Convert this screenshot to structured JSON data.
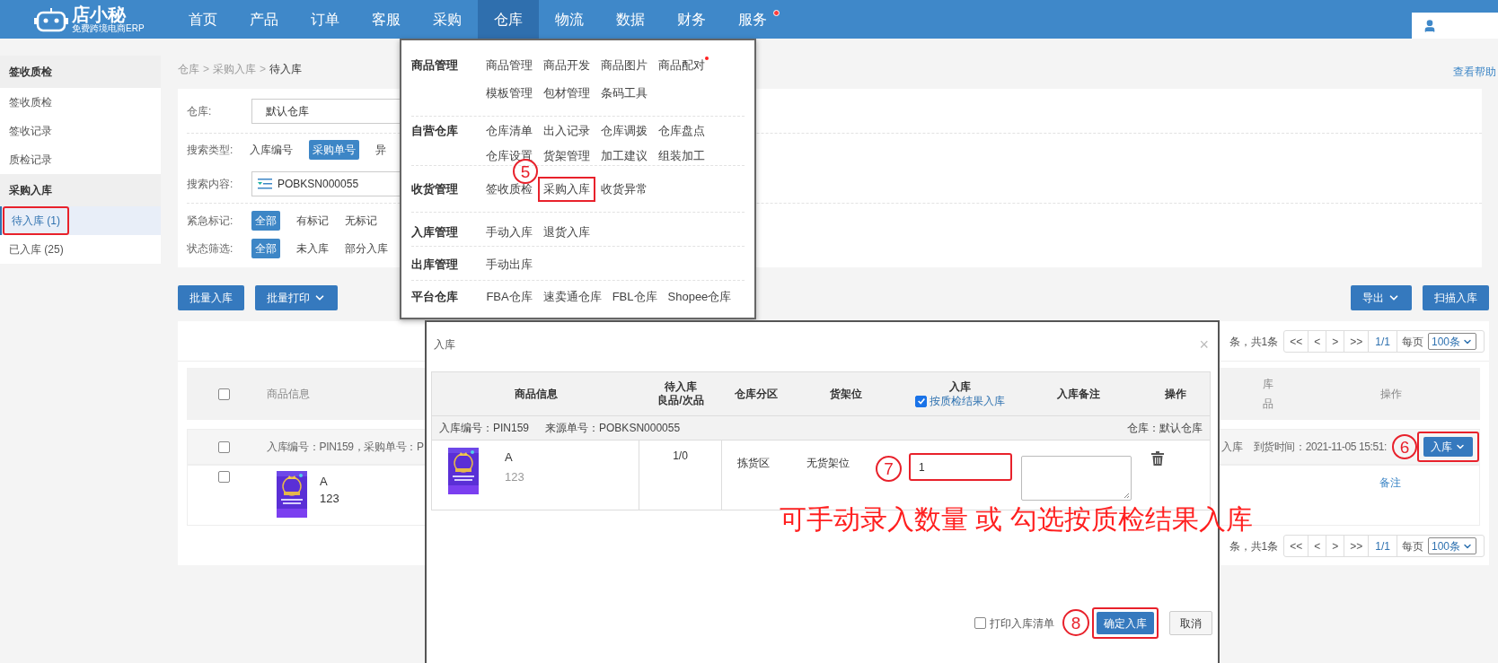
{
  "top_nav": {
    "logo": {
      "name": "店小秘",
      "tagline": "免费跨境电商ERP"
    },
    "items": [
      {
        "label": "首页",
        "selected": false,
        "dot": false
      },
      {
        "label": "产品",
        "selected": false,
        "dot": false
      },
      {
        "label": "订单",
        "selected": false,
        "dot": false
      },
      {
        "label": "客服",
        "selected": false,
        "dot": false
      },
      {
        "label": "采购",
        "selected": false,
        "dot": false
      },
      {
        "label": "仓库",
        "selected": true,
        "dot": false
      },
      {
        "label": "物流",
        "selected": false,
        "dot": false
      },
      {
        "label": "数据",
        "selected": false,
        "dot": false
      },
      {
        "label": "财务",
        "selected": false,
        "dot": false
      },
      {
        "label": "服务",
        "selected": false,
        "dot": true
      }
    ]
  },
  "sidebar": {
    "sections": [
      {
        "title": "签收质检",
        "items": [
          {
            "label": "签收质检",
            "selected": false,
            "highlighted": false
          },
          {
            "label": "签收记录",
            "selected": false,
            "highlighted": false
          },
          {
            "label": "质检记录",
            "selected": false,
            "highlighted": false
          }
        ]
      },
      {
        "title": "采购入库",
        "items": [
          {
            "label": "待入库 (1)",
            "selected": true,
            "highlighted": true
          },
          {
            "label": "已入库 (25)",
            "selected": false,
            "highlighted": false
          }
        ]
      }
    ]
  },
  "breadcrumb": [
    {
      "kind": "link",
      "label": "仓库"
    },
    {
      "kind": "separator",
      "label": ">"
    },
    {
      "kind": "link",
      "label": "采购入库"
    },
    {
      "kind": "separator",
      "label": ">"
    },
    {
      "kind": "current",
      "label": "待入库"
    }
  ],
  "help_link": "查看帮助",
  "filters": {
    "warehouse": {
      "label": "仓库:",
      "value": "默认仓库"
    },
    "search_type": {
      "label": "搜索类型:",
      "options": [
        {
          "label": "入库编号",
          "selected": false
        },
        {
          "label": "采购单号",
          "selected": true
        },
        {
          "label": "异",
          "selected": false
        }
      ]
    },
    "search_content": {
      "label": "搜索内容:",
      "value": "POBKSN000055"
    },
    "urgent_mark": {
      "label": "紧急标记:",
      "options": [
        {
          "label": "全部",
          "selected": true
        },
        {
          "label": "有标记",
          "selected": false
        },
        {
          "label": "无标记",
          "selected": false
        }
      ]
    },
    "status": {
      "label": "状态筛选:",
      "options": [
        {
          "label": "全部",
          "selected": true
        },
        {
          "label": "未入库",
          "selected": false
        },
        {
          "label": "部分入库",
          "selected": false
        }
      ]
    }
  },
  "actions_left": [
    {
      "label": "批量入库",
      "dropdown": false
    },
    {
      "label": "批量打印",
      "dropdown": true
    }
  ],
  "actions_right": [
    {
      "label": "导出",
      "dropdown": true
    },
    {
      "label": "扫描入库",
      "dropdown": false
    }
  ],
  "table": {
    "pagination_top": {
      "summary": "条，共1条",
      "buttons": [
        "<<",
        "<",
        ">",
        ">>"
      ],
      "page": "1/1",
      "per_page_label": "每页",
      "per_page": "100条"
    },
    "header": {
      "checked": false,
      "product": "商品信息",
      "cut_column": [
        "库",
        "品"
      ],
      "actions": "操作"
    },
    "group": {
      "checked": false,
      "info": "入库编号：PIN159，采购单号：P",
      "cut_text": "入库",
      "arrival": "到货时间：2021-11-05 15:51:",
      "action": {
        "label": "入库",
        "highlighted": true
      }
    },
    "product": {
      "checked": false,
      "name": "A",
      "code": "123",
      "note_link": "备注"
    },
    "pagination_bottom": {
      "summary": "条，共1条",
      "buttons": [
        "<<",
        "<",
        ">",
        ">>"
      ],
      "page": "1/1",
      "per_page_label": "每页",
      "per_page": "100条"
    }
  },
  "warehouse_menu": {
    "groups": [
      {
        "title": "商品管理",
        "links": [
          {
            "label": "商品管理",
            "highlighted": false,
            "dot": false
          },
          {
            "label": "商品开发",
            "highlighted": false,
            "dot": false
          },
          {
            "label": "商品图片",
            "highlighted": false,
            "dot": false
          },
          {
            "label": "商品配对",
            "highlighted": false,
            "dot": true
          },
          {
            "label": "模板管理",
            "highlighted": false,
            "dot": false
          },
          {
            "label": "包材管理",
            "highlighted": false,
            "dot": false
          },
          {
            "label": "条码工具",
            "highlighted": false,
            "dot": false
          }
        ]
      },
      {
        "title": "自营仓库",
        "links": [
          {
            "label": "仓库清单",
            "highlighted": false,
            "dot": false
          },
          {
            "label": "出入记录",
            "highlighted": false,
            "dot": false
          },
          {
            "label": "仓库调拨",
            "highlighted": false,
            "dot": false
          },
          {
            "label": "仓库盘点",
            "highlighted": false,
            "dot": false
          },
          {
            "label": "仓库设置",
            "highlighted": false,
            "dot": false
          },
          {
            "label": "货架管理",
            "highlighted": false,
            "dot": false
          },
          {
            "label": "加工建议",
            "highlighted": false,
            "dot": false
          },
          {
            "label": "组装加工",
            "highlighted": false,
            "dot": false
          }
        ]
      },
      {
        "title": "收货管理",
        "links": [
          {
            "label": "签收质检",
            "highlighted": false,
            "dot": false
          },
          {
            "label": "采购入库",
            "highlighted": true,
            "dot": false
          },
          {
            "label": "收货异常",
            "highlighted": false,
            "dot": false
          }
        ]
      },
      {
        "title": "入库管理",
        "links": [
          {
            "label": "手动入库",
            "highlighted": false,
            "dot": false
          },
          {
            "label": "退货入库",
            "highlighted": false,
            "dot": false
          }
        ]
      },
      {
        "title": "出库管理",
        "links": [
          {
            "label": "手动出库",
            "highlighted": false,
            "dot": false
          }
        ]
      },
      {
        "title": "平台仓库",
        "links": [
          {
            "label": "FBA仓库",
            "highlighted": false,
            "dot": false
          },
          {
            "label": "速卖通仓库",
            "highlighted": false,
            "dot": false
          },
          {
            "label": "FBL仓库",
            "highlighted": false,
            "dot": false
          },
          {
            "label": "Shopee仓库",
            "highlighted": false,
            "dot": false
          }
        ]
      }
    ]
  },
  "modal": {
    "title": "入库",
    "close": "×",
    "columns": [
      {
        "kind": "text",
        "label": "商品信息"
      },
      {
        "kind": "stacked",
        "lines": [
          "待入库",
          "良品/次品"
        ]
      },
      {
        "kind": "text",
        "label": "仓库分区"
      },
      {
        "kind": "text",
        "label": "货架位"
      },
      {
        "kind": "check",
        "label": "入库",
        "check_label": "按质检结果入库",
        "checked": true
      },
      {
        "kind": "text",
        "label": "入库备注"
      },
      {
        "kind": "text",
        "label": "操作"
      }
    ],
    "info": {
      "inbound_no": "入库编号：PIN159",
      "source_no": "来源单号：POBKSN000055",
      "warehouse": "仓库：默认仓库"
    },
    "row": {
      "name": "A",
      "code": "123",
      "pending": "1/0",
      "zone": "拣货区",
      "shelf": "无货架位",
      "quantity": "1",
      "quantity_highlighted": true
    },
    "footer": {
      "print_list": {
        "label": "打印入库清单",
        "checked": false
      },
      "confirm": {
        "label": "确定入库",
        "highlighted": true
      },
      "cancel": "取消"
    }
  },
  "annotations": {
    "callout": "可手动录入数量 或 勾选按质检结果入库",
    "steps": [
      "5",
      "6",
      "7",
      "8"
    ]
  }
}
